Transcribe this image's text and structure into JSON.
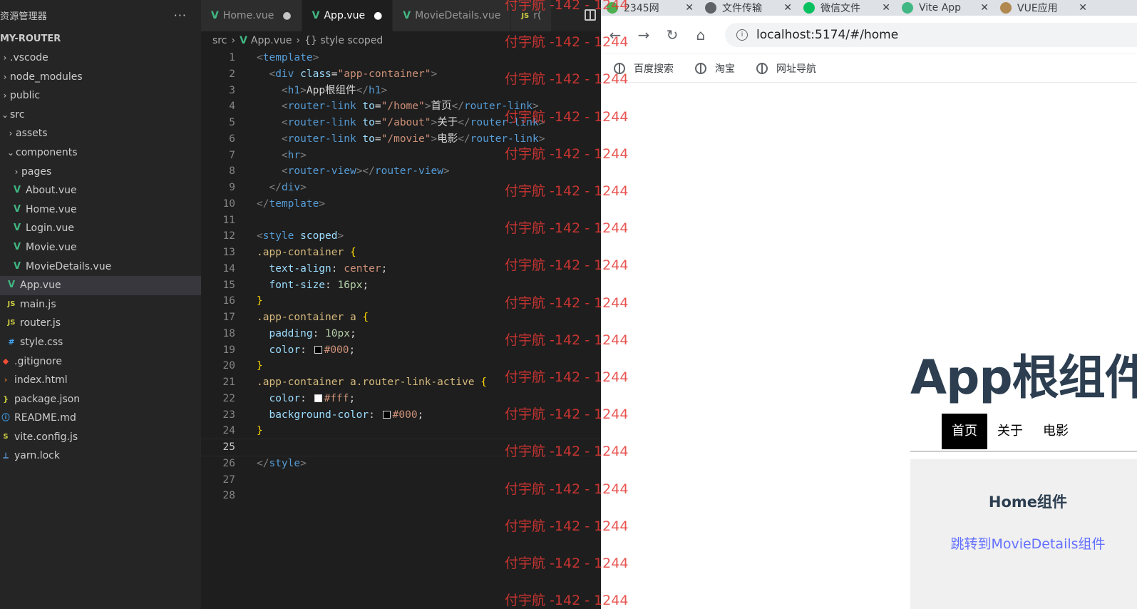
{
  "explorer": {
    "title": "资源管理器",
    "more": "···",
    "project": "MY-ROUTER",
    "items": [
      {
        "label": ".vscode",
        "chev": "›",
        "icon": "",
        "type": "folder"
      },
      {
        "label": "node_modules",
        "chev": "›",
        "icon": "",
        "type": "folder"
      },
      {
        "label": "public",
        "chev": "›",
        "icon": "",
        "type": "folder"
      },
      {
        "label": "src",
        "chev": "⌄",
        "icon": "",
        "type": "folder"
      },
      {
        "label": "assets",
        "chev": "›",
        "icon": "",
        "type": "folder"
      },
      {
        "label": "components",
        "chev": "⌄",
        "icon": "",
        "type": "folder"
      },
      {
        "label": "pages",
        "chev": "›",
        "icon": "",
        "type": "folder"
      },
      {
        "label": "About.vue",
        "chev": "",
        "icon": "V",
        "type": "vue"
      },
      {
        "label": "Home.vue",
        "chev": "",
        "icon": "V",
        "type": "vue"
      },
      {
        "label": "Login.vue",
        "chev": "",
        "icon": "V",
        "type": "vue"
      },
      {
        "label": "Movie.vue",
        "chev": "",
        "icon": "V",
        "type": "vue"
      },
      {
        "label": "MovieDetails.vue",
        "chev": "",
        "icon": "V",
        "type": "vue"
      },
      {
        "label": "App.vue",
        "chev": "",
        "icon": "V",
        "type": "vue"
      },
      {
        "label": "main.js",
        "chev": "",
        "icon": "JS",
        "type": "js"
      },
      {
        "label": "router.js",
        "chev": "",
        "icon": "JS",
        "type": "js"
      },
      {
        "label": "style.css",
        "chev": "",
        "icon": "#",
        "type": "css"
      },
      {
        "label": ".gitignore",
        "chev": "",
        "icon": "◆",
        "type": "git"
      },
      {
        "label": "index.html",
        "chev": "",
        "icon": "›",
        "type": "html"
      },
      {
        "label": "package.json",
        "chev": "",
        "icon": "}",
        "type": "json"
      },
      {
        "label": "README.md",
        "chev": "",
        "icon": "ⓘ",
        "type": "info"
      },
      {
        "label": "vite.config.js",
        "chev": "",
        "icon": "S",
        "type": "js"
      },
      {
        "label": "yarn.lock",
        "chev": "",
        "icon": "⟂",
        "type": "lock"
      }
    ]
  },
  "editor": {
    "tabs": [
      {
        "label": "Home.vue",
        "icon": "V",
        "dot": "●",
        "active": false
      },
      {
        "label": "App.vue",
        "icon": "V",
        "dot": "●",
        "active": true
      },
      {
        "label": "MovieDetails.vue",
        "icon": "V",
        "dot": "",
        "active": false
      },
      {
        "label": "r(",
        "icon": "JS",
        "dot": "",
        "active": false
      }
    ],
    "breadcrumb": {
      "root": "src",
      "file": "App.vue",
      "symbol": "{} style scoped"
    },
    "current_line": 25,
    "lines": [
      [
        [
          "t-punc",
          "<"
        ],
        [
          "t-tag",
          "template"
        ],
        [
          "t-punc",
          ">"
        ]
      ],
      [
        [
          "t-text",
          "  "
        ],
        [
          "t-punc",
          "<"
        ],
        [
          "t-tag",
          "div"
        ],
        [
          "t-text",
          " "
        ],
        [
          "t-attr",
          "class"
        ],
        [
          "t-text",
          "="
        ],
        [
          "t-str",
          "\"app-container\""
        ],
        [
          "t-punc",
          ">"
        ]
      ],
      [
        [
          "t-text",
          "    "
        ],
        [
          "t-punc",
          "<"
        ],
        [
          "t-tag",
          "h1"
        ],
        [
          "t-punc",
          ">"
        ],
        [
          "t-text",
          "App根组件"
        ],
        [
          "t-punc",
          "</"
        ],
        [
          "t-tag",
          "h1"
        ],
        [
          "t-punc",
          ">"
        ]
      ],
      [
        [
          "t-text",
          "    "
        ],
        [
          "t-punc",
          "<"
        ],
        [
          "t-tag",
          "router-link"
        ],
        [
          "t-text",
          " "
        ],
        [
          "t-attr",
          "to"
        ],
        [
          "t-text",
          "="
        ],
        [
          "t-str",
          "\"/home\""
        ],
        [
          "t-punc",
          ">"
        ],
        [
          "t-text",
          "首页"
        ],
        [
          "t-punc",
          "</"
        ],
        [
          "t-tag",
          "router-link"
        ],
        [
          "t-punc",
          ">"
        ]
      ],
      [
        [
          "t-text",
          "    "
        ],
        [
          "t-punc",
          "<"
        ],
        [
          "t-tag",
          "router-link"
        ],
        [
          "t-text",
          " "
        ],
        [
          "t-attr",
          "to"
        ],
        [
          "t-text",
          "="
        ],
        [
          "t-str",
          "\"/about\""
        ],
        [
          "t-punc",
          ">"
        ],
        [
          "t-text",
          "关于"
        ],
        [
          "t-punc",
          "</"
        ],
        [
          "t-tag",
          "router-link"
        ],
        [
          "t-punc",
          ">"
        ]
      ],
      [
        [
          "t-text",
          "    "
        ],
        [
          "t-punc",
          "<"
        ],
        [
          "t-tag",
          "router-link"
        ],
        [
          "t-text",
          " "
        ],
        [
          "t-attr",
          "to"
        ],
        [
          "t-text",
          "="
        ],
        [
          "t-str",
          "\"/movie\""
        ],
        [
          "t-punc",
          ">"
        ],
        [
          "t-text",
          "电影"
        ],
        [
          "t-punc",
          "</"
        ],
        [
          "t-tag",
          "router-link"
        ],
        [
          "t-punc",
          ">"
        ]
      ],
      [
        [
          "t-text",
          "    "
        ],
        [
          "t-punc",
          "<"
        ],
        [
          "t-tag",
          "hr"
        ],
        [
          "t-punc",
          ">"
        ]
      ],
      [
        [
          "t-text",
          "    "
        ],
        [
          "t-punc",
          "<"
        ],
        [
          "t-tag",
          "router-view"
        ],
        [
          "t-punc",
          "></"
        ],
        [
          "t-tag",
          "router-view"
        ],
        [
          "t-punc",
          ">"
        ]
      ],
      [
        [
          "t-text",
          "  "
        ],
        [
          "t-punc",
          "</"
        ],
        [
          "t-tag",
          "div"
        ],
        [
          "t-punc",
          ">"
        ]
      ],
      [
        [
          "t-punc",
          "</"
        ],
        [
          "t-tag",
          "template"
        ],
        [
          "t-punc",
          ">"
        ]
      ],
      [],
      [
        [
          "t-punc",
          "<"
        ],
        [
          "t-tag",
          "style"
        ],
        [
          "t-text",
          " "
        ],
        [
          "t-attr",
          "scoped"
        ],
        [
          "t-punc",
          ">"
        ]
      ],
      [
        [
          "t-sel",
          ".app-container"
        ],
        [
          "t-text",
          " "
        ],
        [
          "t-brace",
          "{"
        ]
      ],
      [
        [
          "t-text",
          "  "
        ],
        [
          "t-prop",
          "text-align"
        ],
        [
          "t-text",
          ": "
        ],
        [
          "t-val",
          "center"
        ],
        [
          "t-text",
          ";"
        ]
      ],
      [
        [
          "t-text",
          "  "
        ],
        [
          "t-prop",
          "font-size"
        ],
        [
          "t-text",
          ": "
        ],
        [
          "t-num",
          "16px"
        ],
        [
          "t-text",
          ";"
        ]
      ],
      [
        [
          "t-brace",
          "}"
        ]
      ],
      [
        [
          "t-sel",
          ".app-container a"
        ],
        [
          "t-text",
          " "
        ],
        [
          "t-brace",
          "{"
        ]
      ],
      [
        [
          "t-text",
          "  "
        ],
        [
          "t-prop",
          "padding"
        ],
        [
          "t-text",
          ": "
        ],
        [
          "t-num",
          "10px"
        ],
        [
          "t-text",
          ";"
        ]
      ],
      [
        [
          "t-text",
          "  "
        ],
        [
          "t-prop",
          "color"
        ],
        [
          "t-text",
          ": "
        ],
        [
          "swatch",
          "#000"
        ],
        [
          "t-val",
          "#000"
        ],
        [
          "t-text",
          ";"
        ]
      ],
      [
        [
          "t-brace",
          "}"
        ]
      ],
      [
        [
          "t-sel",
          ".app-container a.router-link-active"
        ],
        [
          "t-text",
          " "
        ],
        [
          "t-brace",
          "{"
        ]
      ],
      [
        [
          "t-text",
          "  "
        ],
        [
          "t-prop",
          "color"
        ],
        [
          "t-text",
          ": "
        ],
        [
          "swatch",
          "#fff"
        ],
        [
          "t-val",
          "#fff"
        ],
        [
          "t-text",
          ";"
        ]
      ],
      [
        [
          "t-text",
          "  "
        ],
        [
          "t-prop",
          "background-color"
        ],
        [
          "t-text",
          ": "
        ],
        [
          "swatch",
          "#000"
        ],
        [
          "t-val",
          "#000"
        ],
        [
          "t-text",
          ";"
        ]
      ],
      [
        [
          "t-brace",
          "}"
        ]
      ],
      [],
      [
        [
          "t-punc",
          "</"
        ],
        [
          "t-tag",
          "style"
        ],
        [
          "t-punc",
          ">"
        ]
      ],
      [],
      []
    ]
  },
  "watermark": {
    "text": "付宇航 -142 - 1244",
    "rows": 17
  },
  "browser": {
    "tabs": [
      {
        "label": "2345网",
        "icon_color": "#4caf50"
      },
      {
        "label": "文件传输",
        "icon_color": "#5f6368"
      },
      {
        "label": "微信文件",
        "icon_color": "#07c160"
      },
      {
        "label": "Vite App",
        "icon_color": "#41b883"
      },
      {
        "label": "VUE应用",
        "icon_color": "#b08850"
      }
    ],
    "tab_close": "✕",
    "nav": {
      "back": "←",
      "forward": "→",
      "reload": "↻",
      "home": "⌂",
      "info": "i"
    },
    "url": "localhost:5174/#/home",
    "bookmarks": [
      "百度搜索",
      "淘宝",
      "网址导航"
    ],
    "page": {
      "h1": "App根组件",
      "links": [
        "首页",
        "关于",
        "电影"
      ],
      "active_link": 0,
      "home_title": "Home组件",
      "home_link": "跳转到MovieDetails组件"
    }
  }
}
